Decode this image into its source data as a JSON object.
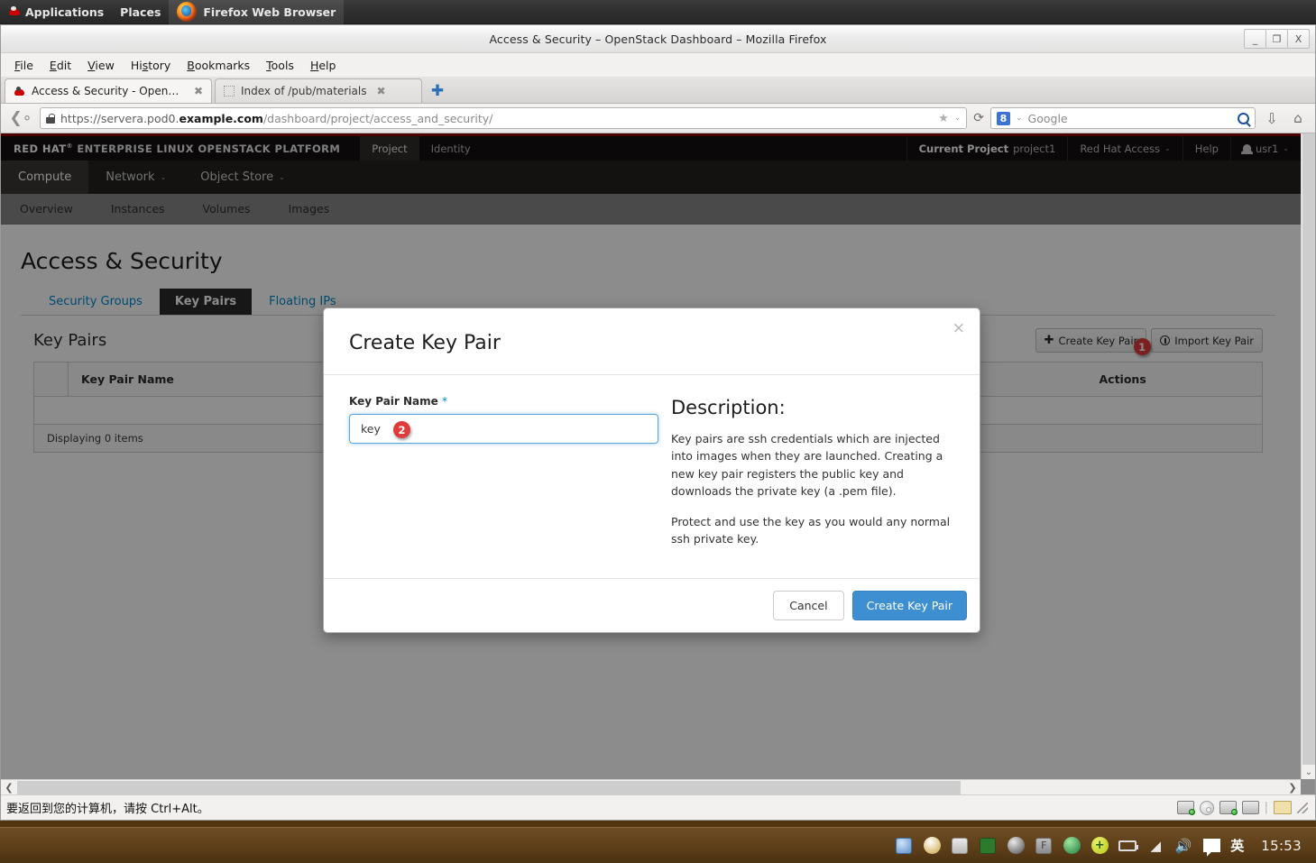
{
  "gnome_panel": {
    "applications": "Applications",
    "places": "Places",
    "window_label": "Firefox Web Browser"
  },
  "window": {
    "title": "Access & Security – OpenStack Dashboard – Mozilla Firefox",
    "minimize": "_",
    "maximize": "❐",
    "close": "X"
  },
  "menubar": [
    "File",
    "Edit",
    "View",
    "History",
    "Bookmarks",
    "Tools",
    "Help"
  ],
  "tabs": [
    {
      "title": "Access & Security - OpenSt...",
      "favicon": "redhat-icon",
      "selected": true,
      "close": "✖"
    },
    {
      "title": "Index of /pub/materials",
      "favicon": "blank-page-icon",
      "selected": false,
      "close": "✖"
    }
  ],
  "new_tab_label": "✚",
  "navbar": {
    "back_icon": "back-arrow-icon",
    "url_scheme": "https://",
    "url_host_prefix": "servera.pod0.",
    "url_host_bold": "example.com",
    "url_path": "/dashboard/project/access_and_security/",
    "star_icon": "★",
    "chevron": "⌄",
    "reload_icon": "⟳",
    "search_engine": "8",
    "search_placeholder": "Google",
    "search_icon": "magnifier-icon",
    "download_icon": "⇩",
    "home_icon": "⌂"
  },
  "openstack": {
    "brand_prefix": "RED HAT",
    "brand_reg": "®",
    "brand_rest": "ENTERPRISE LINUX OPENSTACK PLATFORM",
    "nav": [
      {
        "label": "Project",
        "active": true
      },
      {
        "label": "Identity",
        "active": false
      }
    ],
    "right": {
      "current_project_label": "Current Project",
      "current_project_value": "project1",
      "redhat_access": "Red Hat Access",
      "help": "Help",
      "user": "usr1"
    },
    "sub_nav": [
      {
        "label": "Compute",
        "active": true,
        "caret": ""
      },
      {
        "label": "Network",
        "active": false,
        "caret": "⌄"
      },
      {
        "label": "Object Store",
        "active": false,
        "caret": "⌄"
      }
    ],
    "third_nav": [
      "Overview",
      "Instances",
      "Volumes",
      "Images"
    ]
  },
  "page": {
    "title": "Access & Security",
    "tabs": [
      {
        "label": "Security Groups",
        "selected": false
      },
      {
        "label": "Key Pairs",
        "selected": true
      },
      {
        "label": "Floating IPs",
        "selected": false
      }
    ],
    "table_title": "Key Pairs",
    "buttons": {
      "create_key_pair": "Create Key Pair",
      "create_icon": "plus-icon",
      "import_key_pair": "Import Key Pair",
      "import_icon": "upload-circle-icon"
    },
    "table_headers": [
      "Key Pair Name",
      "Actions"
    ],
    "table_rows": [],
    "footer_text": "Displaying 0 items"
  },
  "modal": {
    "title": "Create Key Pair",
    "close_icon": "×",
    "field_label": "Key Pair Name",
    "field_required_mark": "*",
    "field_value": "key",
    "description_heading": "Description:",
    "description_paragraphs": [
      "Key pairs are ssh credentials which are injected into images when they are launched. Creating a new key pair registers the public key and downloads the private key (a .pem file).",
      "Protect and use the key as you would any normal ssh private key."
    ],
    "cancel_label": "Cancel",
    "submit_label": "Create Key Pair"
  },
  "annotations": {
    "badge_one": "1",
    "badge_two": "2",
    "badge_color": "#e03b3b"
  },
  "statusbar": {
    "message": "要返回到您的计算机，请按 Ctrl+Alt。"
  },
  "taskbar": {
    "clock": "15:53",
    "language": "英"
  }
}
